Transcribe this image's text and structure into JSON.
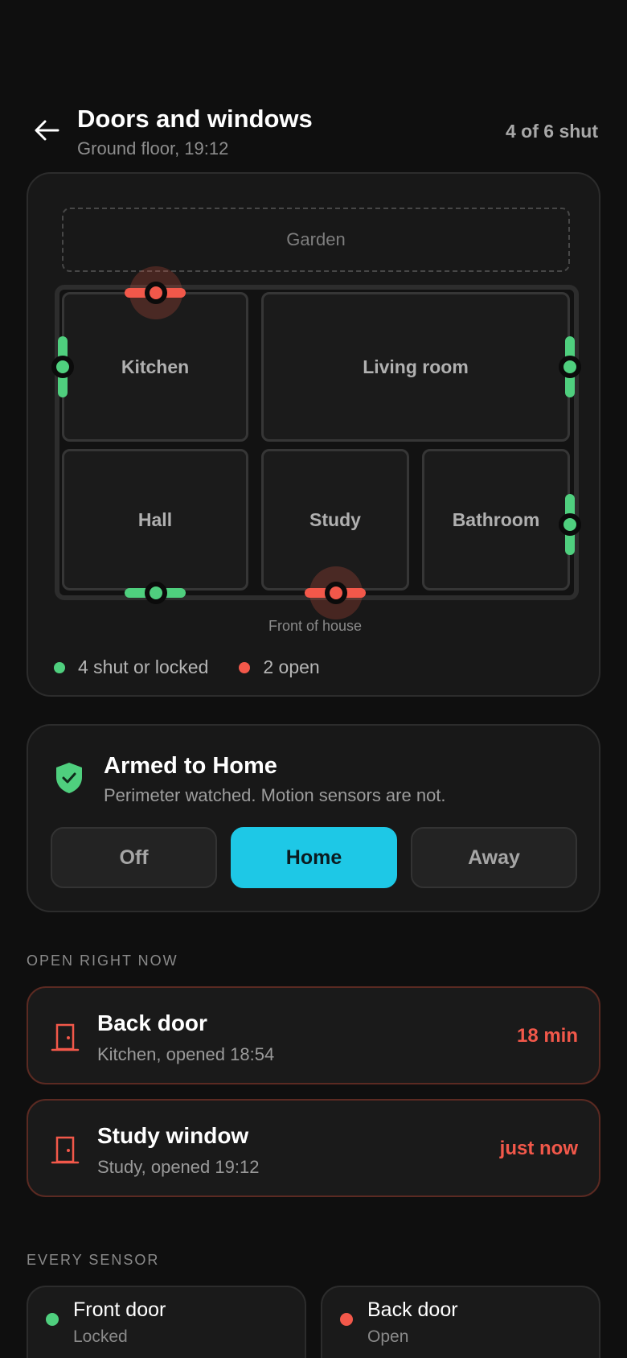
{
  "header": {
    "title": "Doors and windows",
    "subtitle": "Ground floor, 19:12",
    "shut_count": "4 of 6 shut"
  },
  "map": {
    "garden": "Garden",
    "rooms": {
      "kitchen": "Kitchen",
      "living": "Living room",
      "hall": "Hall",
      "study": "Study",
      "bathroom": "Bathroom"
    },
    "front_label": "Front of house",
    "legend_shut": "4 shut or locked",
    "legend_open": "2 open"
  },
  "alarm": {
    "title": "Armed to Home",
    "description": "Perimeter watched. Motion sensors are not.",
    "modes": [
      "Off",
      "Home",
      "Away"
    ],
    "active_mode": "Home"
  },
  "open_now": {
    "label": "OPEN RIGHT NOW",
    "items": [
      {
        "title": "Back door",
        "subtitle": "Kitchen, opened 18:54",
        "time": "18 min"
      },
      {
        "title": "Study window",
        "subtitle": "Study, opened 19:12",
        "time": "just now"
      }
    ]
  },
  "every_sensor": {
    "label": "EVERY SENSOR",
    "items": [
      {
        "title": "Front door",
        "status": "Locked"
      },
      {
        "title": "Back door",
        "status": "Open"
      }
    ]
  },
  "colors": {
    "shut": "#4fcf7e",
    "open": "#f2584a",
    "accent": "#1ec8e6"
  }
}
